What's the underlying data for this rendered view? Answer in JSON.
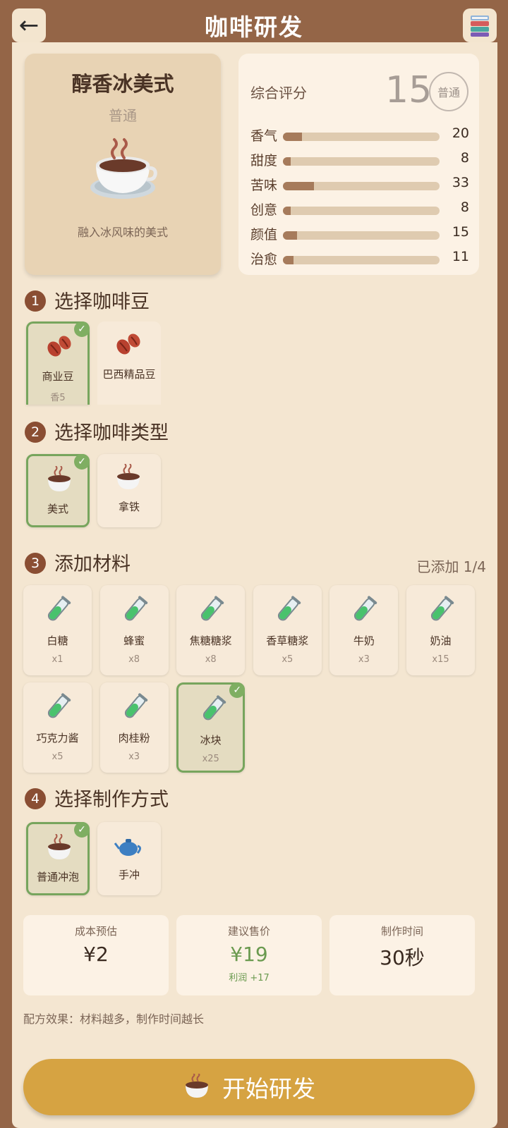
{
  "header": {
    "title": "咖啡研发",
    "back_icon": "back-arrow-icon",
    "book_icon": "recipe-book-icon"
  },
  "preview": {
    "name": "醇香冰美式",
    "grade": "普通",
    "description": "融入冰风味的美式"
  },
  "score": {
    "label": "综合评分",
    "value": "15",
    "badge": "普通",
    "stats": [
      {
        "name": "香气",
        "value": "20"
      },
      {
        "name": "甜度",
        "value": "8"
      },
      {
        "name": "苦味",
        "value": "33"
      },
      {
        "name": "创意",
        "value": "8"
      },
      {
        "name": "颜值",
        "value": "15"
      },
      {
        "name": "治愈",
        "value": "11"
      }
    ]
  },
  "sections": {
    "beans": {
      "num": "1",
      "title": "选择咖啡豆"
    },
    "types": {
      "num": "2",
      "title": "选择咖啡类型"
    },
    "materials": {
      "num": "3",
      "title": "添加材料",
      "added": "已添加 1/4"
    },
    "methods": {
      "num": "4",
      "title": "选择制作方式"
    }
  },
  "beans": [
    {
      "label": "商业豆",
      "sub": "香5",
      "selected": true
    },
    {
      "label": "巴西精品豆",
      "sub": "",
      "selected": false
    }
  ],
  "types": [
    {
      "label": "美式",
      "selected": true
    },
    {
      "label": "拿铁",
      "selected": false
    }
  ],
  "materials": [
    {
      "label": "白糖",
      "count": "x1"
    },
    {
      "label": "蜂蜜",
      "count": "x8"
    },
    {
      "label": "焦糖糖浆",
      "count": "x8"
    },
    {
      "label": "香草糖浆",
      "count": "x5"
    },
    {
      "label": "牛奶",
      "count": "x3"
    },
    {
      "label": "奶油",
      "count": "x15"
    },
    {
      "label": "巧克力酱",
      "count": "x5"
    },
    {
      "label": "肉桂粉",
      "count": "x3"
    },
    {
      "label": "冰块",
      "count": "x25",
      "selected": true
    }
  ],
  "methods": [
    {
      "label": "普通冲泡",
      "selected": true
    },
    {
      "label": "手冲",
      "selected": false
    }
  ],
  "info": {
    "cost": {
      "label": "成本预估",
      "value": "¥2"
    },
    "price": {
      "label": "建议售价",
      "value": "¥19",
      "profit": "利润 +17"
    },
    "time": {
      "label": "制作时间",
      "value": "30秒"
    }
  },
  "effect": "配方效果：材料越多，制作时间越长",
  "start_label": "开始研发",
  "colors": {
    "header": "#946547",
    "panel": "#f4e6d1",
    "accent_green": "#77a55d",
    "button": "#d6a342"
  }
}
